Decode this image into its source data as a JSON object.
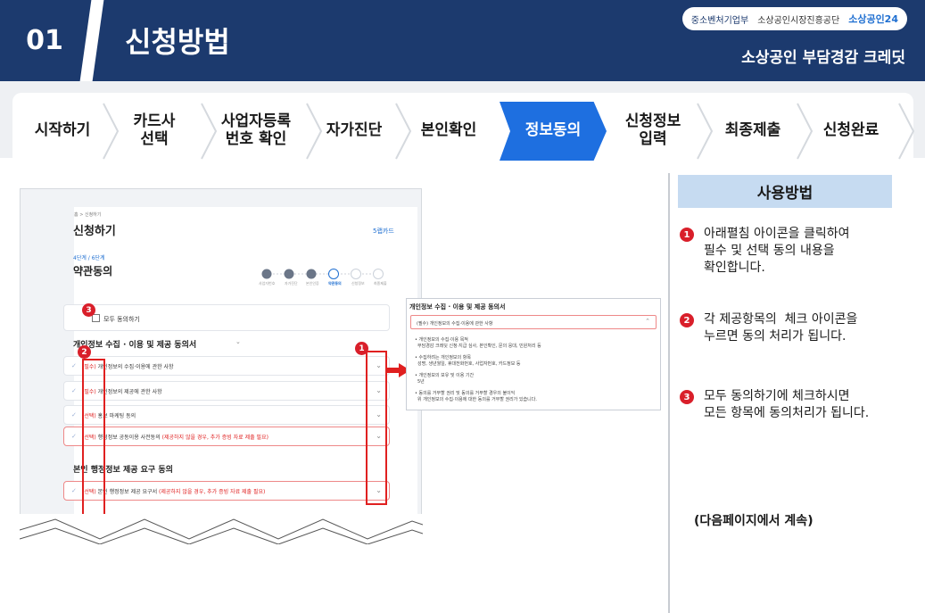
{
  "header": {
    "number": "01",
    "title": "신청방법",
    "subtitle": "소상공인 부담경감 크레딧",
    "logos": [
      "중소벤처기업부",
      "소상공인시장진흥공단",
      "소상공인24"
    ]
  },
  "steps": [
    {
      "label": "시작하기",
      "active": false
    },
    {
      "label": "카드사\n선택",
      "active": false
    },
    {
      "label": "사업자등록\n번호 확인",
      "active": false
    },
    {
      "label": "자가진단",
      "active": false
    },
    {
      "label": "본인확인",
      "active": false
    },
    {
      "label": "정보동의",
      "active": true
    },
    {
      "label": "신청정보\n입력",
      "active": false
    },
    {
      "label": "최종제출",
      "active": false
    },
    {
      "label": "신청완료",
      "active": false
    }
  ],
  "screenshot": {
    "breadcrumb": "홈 > 신청하기",
    "page_title": "신청하기",
    "card_name": "5랩카드",
    "step_count": "4단계 / 6단계",
    "section_title": "약관동의",
    "progress_labels": [
      "사업자번호",
      "자가진단",
      "본인인증",
      "약관동의",
      "신청정보",
      "최종제출"
    ],
    "agree_all": "모두 동의하기",
    "privacy_title": "개인정보 수집 · 이용 및 제공 동의서",
    "rows": [
      {
        "tag": "(필수)",
        "text": "개인정보의 수집·이용에 관한 사항",
        "note": ""
      },
      {
        "tag": "(필수)",
        "text": "개인정보의 제공에 관한 사항",
        "note": ""
      },
      {
        "tag": "(선택)",
        "text": "홍보 마케팅 동의",
        "note": ""
      },
      {
        "tag": "(선택)",
        "text": "행정정보 공동이용 사전동의",
        "note": "(제공하지 않을 경우, 추가 증빙 자료 제출 필요)"
      }
    ],
    "admin_title": "본인 행정정보 제공 요구 동의",
    "admin_row": {
      "tag": "(선택)",
      "text": "본인 행정정보 제공 요구서",
      "note": "(제공하지 않을 경우, 추가 증빙 자료 제출 필요)"
    },
    "popup": {
      "title": "개인정보 수집 · 이용 및 제공 동의서",
      "row": "(필수) 개인정보의 수집·이용에 관한 사항",
      "lines": [
        "• 개인정보의 수집·이용 목적",
        "부담경감 크레딧 신청·지급 심사, 본인확인, 문의 응대, 민원처리 등",
        "• 수집하려는 개인정보의 항목",
        "성명, 생년월일, 휴대전화번호, 사업자번호, 카드정보 등",
        "• 개인정보의 보유 및 이용 기간",
        "5년",
        "• 동의를 거부할 권리 및 동의를 거부할 경우의 불이익",
        "위 개인정보의 수집·이용에 대한 동의를 거부할 권리가 있습니다."
      ]
    },
    "badges": [
      "1",
      "2",
      "3"
    ]
  },
  "sidebar": {
    "heading": "사용방법",
    "instructions": [
      {
        "num": "1",
        "text": "아래펼침 아이콘을 클릭하여\n필수 및 선택 동의 내용을\n확인합니다."
      },
      {
        "num": "2",
        "text": "각 제공항목의  체크 아이콘을\n누르면 동의 처리가 됩니다."
      },
      {
        "num": "3",
        "text": "모두 동의하기에 체크하시면\n모든 항목에 동의처리가 됩니다."
      }
    ],
    "continued": "(다음페이지에서 계속)"
  }
}
